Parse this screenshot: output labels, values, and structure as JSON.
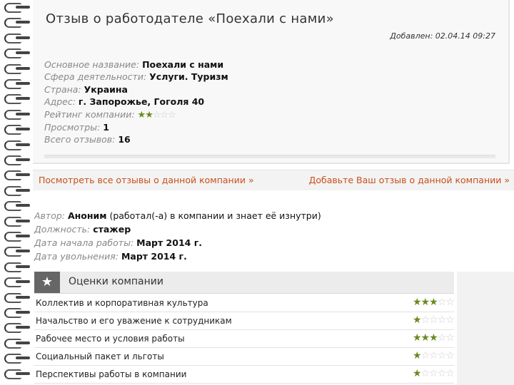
{
  "header": {
    "title": "Отзыв о работодателе «Поехали с нами»",
    "added": "Добавлен: 02.04.14 09:27"
  },
  "company": {
    "name_label": "Основное название: ",
    "name": "Поехали с нами",
    "sphere_label": "Сфера деятельности: ",
    "sphere": "Услуги. Туризм",
    "country_label": "Страна: ",
    "country": "Украина",
    "address_label": "Адрес: ",
    "address": "г. Запорожье, Гоголя 40",
    "rating_label": "Рейтинг компании: ",
    "rating": 2,
    "rating_max": 5,
    "views_label": "Просмотры: ",
    "views": "1",
    "reviews_label": "Всего отзывов: ",
    "reviews": "16"
  },
  "links": {
    "all_reviews": "Посмотреть все отзывы о данной компании »",
    "add_review": "Добавьте Ваш отзыв о данной компании »"
  },
  "author": {
    "author_label": "Автор: ",
    "author_name": "Аноним",
    "author_note": " (работал(-а) в компании и знает её изнутри)",
    "position_label": "Должность: ",
    "position": "стажер",
    "start_label": "Дата начала работы: ",
    "start": "Март 2014 г.",
    "end_label": "Дата увольнения: ",
    "end": "Март 2014 г."
  },
  "ratings": {
    "title": "Оценки компании",
    "items": [
      {
        "label": "Коллектив и корпоративная культура",
        "stars": 3
      },
      {
        "label": "Начальство и его уважение к сотрудникам",
        "stars": 1
      },
      {
        "label": "Рабочее место и условия работы",
        "stars": 3
      },
      {
        "label": "Социальный пакет и льготы",
        "stars": 1
      },
      {
        "label": "Перспективы работы в компании",
        "stars": 1
      }
    ]
  },
  "colors": {
    "link": "#c8501a",
    "star_on": "#6b8a1e",
    "star_off": "#cccccc"
  }
}
